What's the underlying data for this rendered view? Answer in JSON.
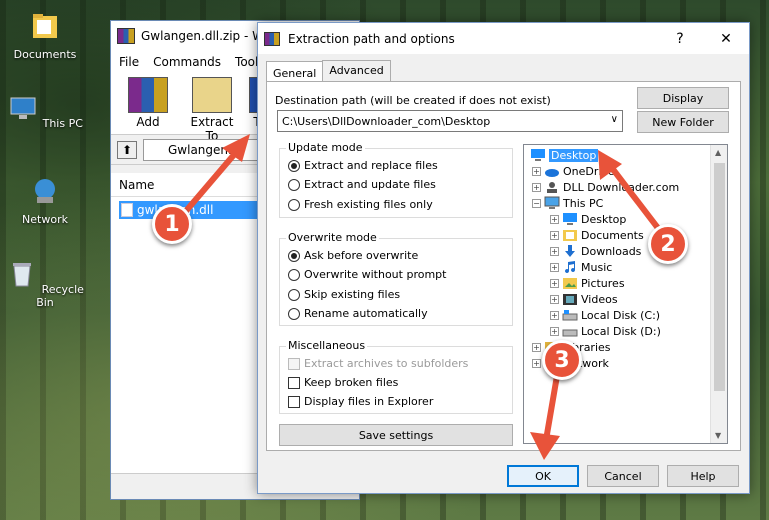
{
  "desktop": {
    "icons": [
      {
        "label": "Documents"
      },
      {
        "label": "This PC"
      },
      {
        "label": "Network"
      },
      {
        "label": "Recycle Bin"
      }
    ]
  },
  "winrar": {
    "title": "Gwlangen.dll.zip - W",
    "menu": [
      "File",
      "Commands",
      "Tools"
    ],
    "toolbar": [
      {
        "label": "Add"
      },
      {
        "label": "Extract To"
      },
      {
        "label": "T"
      }
    ],
    "path": "Gwlangen.d",
    "list_header": "Name",
    "file": "gwlangen.dll"
  },
  "dialog": {
    "title": "Extraction path and options",
    "help_glyph": "?",
    "close_glyph": "✕",
    "tabs": [
      "General",
      "Advanced"
    ],
    "dest_label": "Destination path (will be created if does not exist)",
    "dest_value": "C:\\Users\\DllDownloader_com\\Desktop",
    "display_btn": "Display",
    "new_folder_btn": "New Folder",
    "update_mode": {
      "title": "Update mode",
      "options": [
        "Extract and replace files",
        "Extract and update files",
        "Fresh existing files only"
      ],
      "selected": 0
    },
    "overwrite_mode": {
      "title": "Overwrite mode",
      "options": [
        "Ask before overwrite",
        "Overwrite without prompt",
        "Skip existing files",
        "Rename automatically"
      ],
      "selected": 0
    },
    "misc": {
      "title": "Miscellaneous",
      "options": [
        "Extract archives to subfolders",
        "Keep broken files",
        "Display files in Explorer"
      ]
    },
    "save_settings_btn": "Save settings",
    "tree": {
      "items": [
        "Desktop",
        "OneDrive",
        "DLL Downloader.com",
        "This PC",
        "Desktop",
        "Documents",
        "Downloads",
        "Music",
        "Pictures",
        "Videos",
        "Local Disk (C:)",
        "Local Disk (D:)",
        "Libraries",
        "Network"
      ],
      "selected": "Desktop"
    },
    "ok_btn": "OK",
    "cancel_btn": "Cancel",
    "help_btn": "Help"
  },
  "annotations": {
    "markers": [
      "1",
      "2",
      "3"
    ],
    "color": "#e8533a"
  },
  "colors": {
    "selection": "#3399ff",
    "default_button_border": "#0078d7"
  }
}
